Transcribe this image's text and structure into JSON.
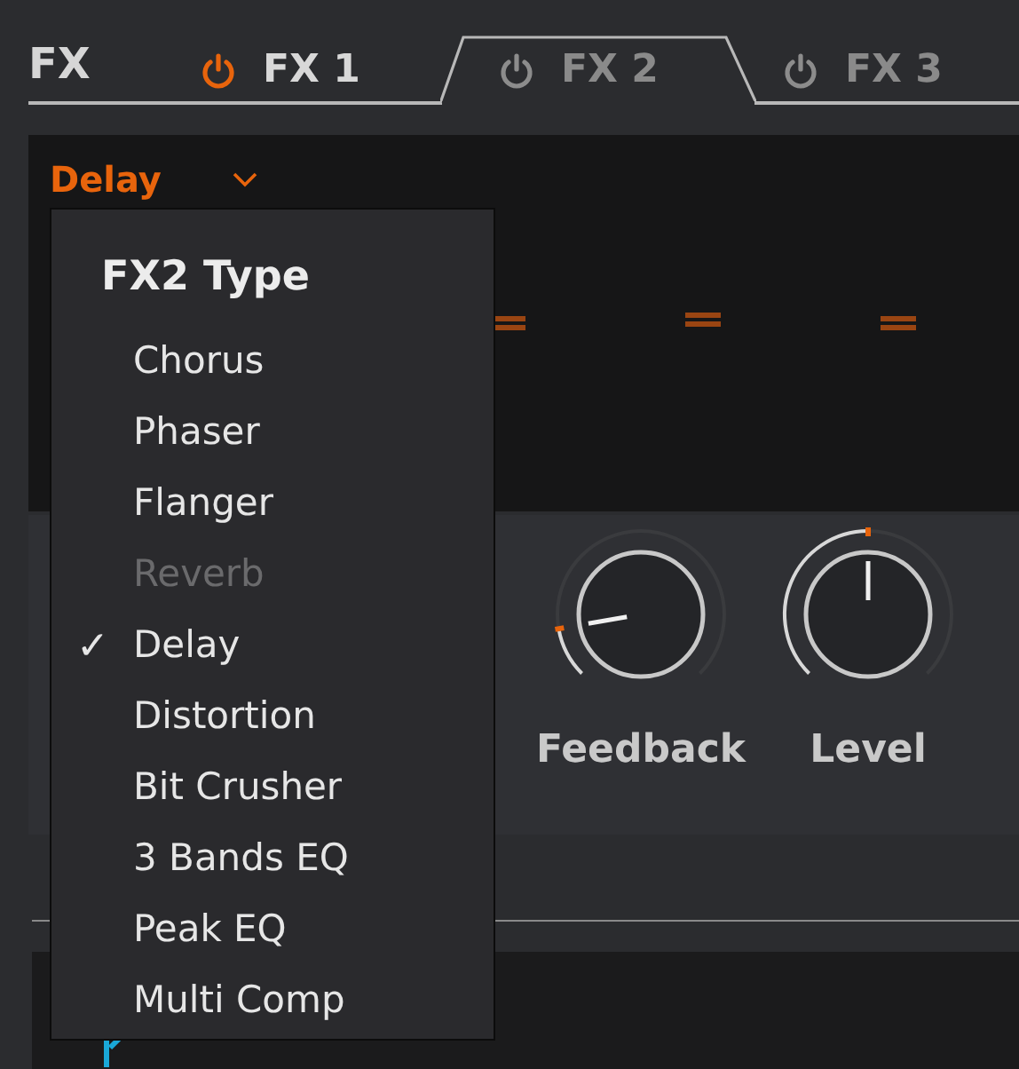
{
  "section_title": "FX",
  "tabs": [
    {
      "label": "FX 1",
      "on": true,
      "selected": false
    },
    {
      "label": "FX 2",
      "on": false,
      "selected": true
    },
    {
      "label": "FX 3",
      "on": false,
      "selected": false
    }
  ],
  "type_dropdown": {
    "value": "Delay"
  },
  "knobs": [
    {
      "label": "Feedback",
      "level": 0.13
    },
    {
      "label": "Level",
      "level": 0.5
    }
  ],
  "menu": {
    "title": "FX2 Type",
    "items": [
      {
        "label": "Chorus",
        "checked": false,
        "disabled": false
      },
      {
        "label": "Phaser",
        "checked": false,
        "disabled": false
      },
      {
        "label": "Flanger",
        "checked": false,
        "disabled": false
      },
      {
        "label": "Reverb",
        "checked": false,
        "disabled": true
      },
      {
        "label": "Delay",
        "checked": true,
        "disabled": false
      },
      {
        "label": "Distortion",
        "checked": false,
        "disabled": false
      },
      {
        "label": "Bit Crusher",
        "checked": false,
        "disabled": false
      },
      {
        "label": "3 Bands EQ",
        "checked": false,
        "disabled": false
      },
      {
        "label": "Peak EQ",
        "checked": false,
        "disabled": false
      },
      {
        "label": "Multi Comp",
        "checked": false,
        "disabled": false
      }
    ],
    "check_mark": "✓"
  }
}
